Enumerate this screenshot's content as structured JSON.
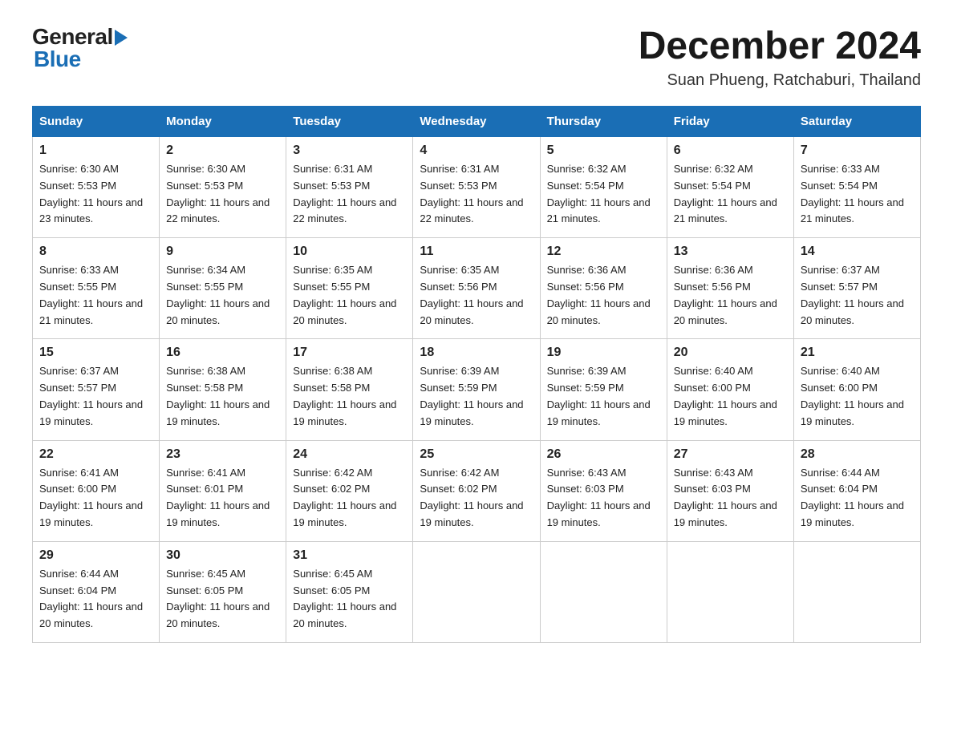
{
  "header": {
    "logo_general": "General",
    "logo_blue": "Blue",
    "title": "December 2024",
    "subtitle": "Suan Phueng, Ratchaburi, Thailand"
  },
  "days_of_week": [
    "Sunday",
    "Monday",
    "Tuesday",
    "Wednesday",
    "Thursday",
    "Friday",
    "Saturday"
  ],
  "weeks": [
    [
      {
        "day": 1,
        "sunrise": "6:30 AM",
        "sunset": "5:53 PM",
        "daylight": "11 hours and 23 minutes."
      },
      {
        "day": 2,
        "sunrise": "6:30 AM",
        "sunset": "5:53 PM",
        "daylight": "11 hours and 22 minutes."
      },
      {
        "day": 3,
        "sunrise": "6:31 AM",
        "sunset": "5:53 PM",
        "daylight": "11 hours and 22 minutes."
      },
      {
        "day": 4,
        "sunrise": "6:31 AM",
        "sunset": "5:53 PM",
        "daylight": "11 hours and 22 minutes."
      },
      {
        "day": 5,
        "sunrise": "6:32 AM",
        "sunset": "5:54 PM",
        "daylight": "11 hours and 21 minutes."
      },
      {
        "day": 6,
        "sunrise": "6:32 AM",
        "sunset": "5:54 PM",
        "daylight": "11 hours and 21 minutes."
      },
      {
        "day": 7,
        "sunrise": "6:33 AM",
        "sunset": "5:54 PM",
        "daylight": "11 hours and 21 minutes."
      }
    ],
    [
      {
        "day": 8,
        "sunrise": "6:33 AM",
        "sunset": "5:55 PM",
        "daylight": "11 hours and 21 minutes."
      },
      {
        "day": 9,
        "sunrise": "6:34 AM",
        "sunset": "5:55 PM",
        "daylight": "11 hours and 20 minutes."
      },
      {
        "day": 10,
        "sunrise": "6:35 AM",
        "sunset": "5:55 PM",
        "daylight": "11 hours and 20 minutes."
      },
      {
        "day": 11,
        "sunrise": "6:35 AM",
        "sunset": "5:56 PM",
        "daylight": "11 hours and 20 minutes."
      },
      {
        "day": 12,
        "sunrise": "6:36 AM",
        "sunset": "5:56 PM",
        "daylight": "11 hours and 20 minutes."
      },
      {
        "day": 13,
        "sunrise": "6:36 AM",
        "sunset": "5:56 PM",
        "daylight": "11 hours and 20 minutes."
      },
      {
        "day": 14,
        "sunrise": "6:37 AM",
        "sunset": "5:57 PM",
        "daylight": "11 hours and 20 minutes."
      }
    ],
    [
      {
        "day": 15,
        "sunrise": "6:37 AM",
        "sunset": "5:57 PM",
        "daylight": "11 hours and 19 minutes."
      },
      {
        "day": 16,
        "sunrise": "6:38 AM",
        "sunset": "5:58 PM",
        "daylight": "11 hours and 19 minutes."
      },
      {
        "day": 17,
        "sunrise": "6:38 AM",
        "sunset": "5:58 PM",
        "daylight": "11 hours and 19 minutes."
      },
      {
        "day": 18,
        "sunrise": "6:39 AM",
        "sunset": "5:59 PM",
        "daylight": "11 hours and 19 minutes."
      },
      {
        "day": 19,
        "sunrise": "6:39 AM",
        "sunset": "5:59 PM",
        "daylight": "11 hours and 19 minutes."
      },
      {
        "day": 20,
        "sunrise": "6:40 AM",
        "sunset": "6:00 PM",
        "daylight": "11 hours and 19 minutes."
      },
      {
        "day": 21,
        "sunrise": "6:40 AM",
        "sunset": "6:00 PM",
        "daylight": "11 hours and 19 minutes."
      }
    ],
    [
      {
        "day": 22,
        "sunrise": "6:41 AM",
        "sunset": "6:00 PM",
        "daylight": "11 hours and 19 minutes."
      },
      {
        "day": 23,
        "sunrise": "6:41 AM",
        "sunset": "6:01 PM",
        "daylight": "11 hours and 19 minutes."
      },
      {
        "day": 24,
        "sunrise": "6:42 AM",
        "sunset": "6:02 PM",
        "daylight": "11 hours and 19 minutes."
      },
      {
        "day": 25,
        "sunrise": "6:42 AM",
        "sunset": "6:02 PM",
        "daylight": "11 hours and 19 minutes."
      },
      {
        "day": 26,
        "sunrise": "6:43 AM",
        "sunset": "6:03 PM",
        "daylight": "11 hours and 19 minutes."
      },
      {
        "day": 27,
        "sunrise": "6:43 AM",
        "sunset": "6:03 PM",
        "daylight": "11 hours and 19 minutes."
      },
      {
        "day": 28,
        "sunrise": "6:44 AM",
        "sunset": "6:04 PM",
        "daylight": "11 hours and 19 minutes."
      }
    ],
    [
      {
        "day": 29,
        "sunrise": "6:44 AM",
        "sunset": "6:04 PM",
        "daylight": "11 hours and 20 minutes."
      },
      {
        "day": 30,
        "sunrise": "6:45 AM",
        "sunset": "6:05 PM",
        "daylight": "11 hours and 20 minutes."
      },
      {
        "day": 31,
        "sunrise": "6:45 AM",
        "sunset": "6:05 PM",
        "daylight": "11 hours and 20 minutes."
      },
      null,
      null,
      null,
      null
    ]
  ]
}
